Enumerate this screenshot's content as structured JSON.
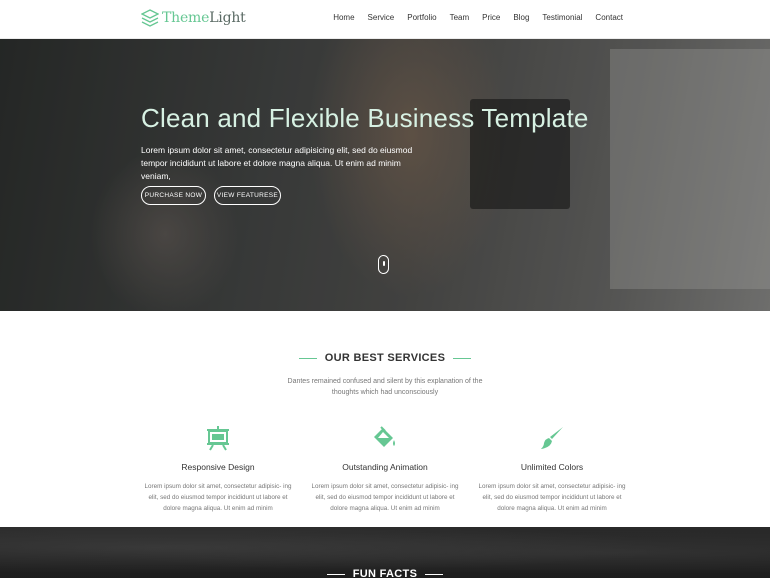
{
  "brand": {
    "part1": "Theme",
    "part2": "Light"
  },
  "nav": [
    "Home",
    "Service",
    "Portfolio",
    "Team",
    "Price",
    "Blog",
    "Testimonial",
    "Contact"
  ],
  "hero": {
    "title": "Clean and Flexible Business Template",
    "text": "Lorem ipsum dolor sit amet, consectetur adipisicing elit, sed do eiusmod tempor incididunt ut labore et dolore magna aliqua. Ut enim ad minim veniam,",
    "btn_purchase": "PURCHASE NOW",
    "btn_view": "VIEW FEATURESE"
  },
  "services": {
    "title": "OUR BEST SERVICES",
    "subtitle": "Dantes remained confused and silent by this explanation of the thoughts which had unconsciously",
    "items": [
      {
        "icon": "easel-icon",
        "title": "Responsive Design",
        "text": "Lorem ipsum dolor sit amet, consectetur adipisic- ing elit, sed do eiusmod tempor incididunt ut labore et dolore magna aliqua. Ut enim ad minim"
      },
      {
        "icon": "paint-bucket-icon",
        "title": "Outstanding Animation",
        "text": "Lorem ipsum dolor sit amet, consectetur adipisic- ing elit, sed do eiusmod tempor incididunt ut labore et dolore magna aliqua. Ut enim ad minim"
      },
      {
        "icon": "paint-brush-icon",
        "title": "Unlimited Colors",
        "text": "Lorem ipsum dolor sit amet, consectetur adipisic- ing elit, sed do eiusmod tempor incididunt ut labore et dolore magna aliqua. Ut enim ad minim"
      }
    ]
  },
  "facts": {
    "title": "FUN FACTS"
  },
  "colors": {
    "accent": "#66c793",
    "dark": "#333333",
    "muted": "#777777"
  }
}
